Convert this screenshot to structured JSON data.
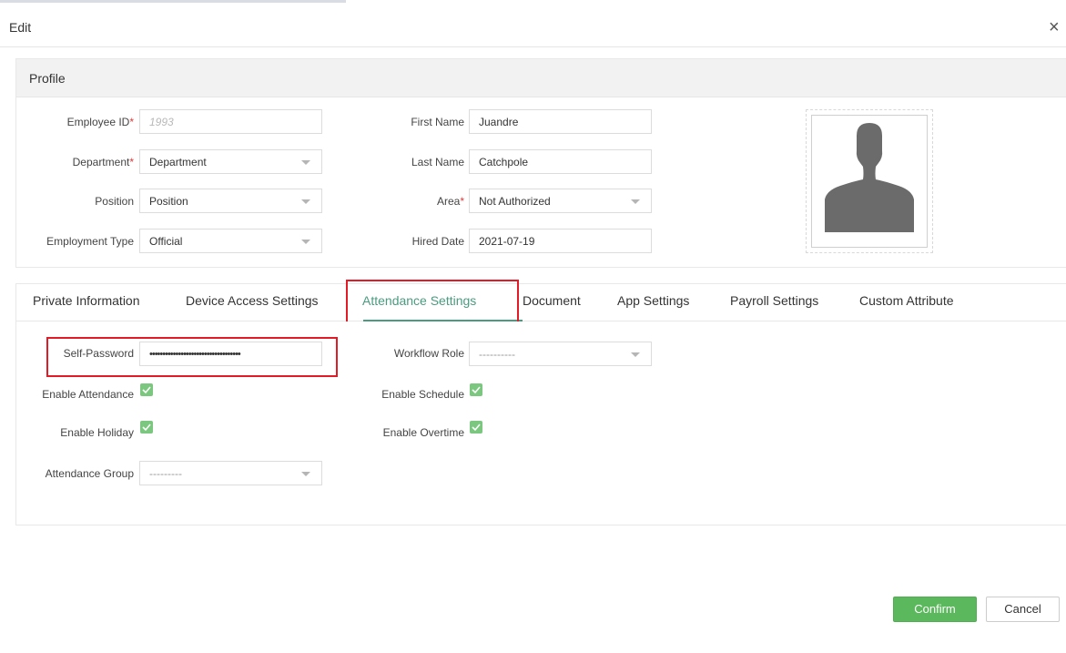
{
  "dialog": {
    "title": "Edit",
    "close_icon": "close-icon"
  },
  "profile": {
    "header": "Profile",
    "employee_id": {
      "label": "Employee ID",
      "placeholder": "1993"
    },
    "department": {
      "label": "Department",
      "value": "Department"
    },
    "position": {
      "label": "Position",
      "value": "Position"
    },
    "employment_type": {
      "label": "Employment Type",
      "value": "Official"
    },
    "first_name": {
      "label": "First Name",
      "value": "Juandre"
    },
    "last_name": {
      "label": "Last Name",
      "value": "Catchpole"
    },
    "area": {
      "label": "Area",
      "value": "Not Authorized"
    },
    "hired_date": {
      "label": "Hired Date",
      "value": "2021-07-19"
    },
    "required_mark": "*",
    "photo_icon": "avatar-placeholder-icon"
  },
  "tabs": [
    {
      "label": "Private Information"
    },
    {
      "label": "Device Access Settings"
    },
    {
      "label": "Attendance Settings",
      "active": true
    },
    {
      "label": "Document"
    },
    {
      "label": "App Settings"
    },
    {
      "label": "Payroll Settings"
    },
    {
      "label": "Custom Attribute"
    }
  ],
  "attendance": {
    "self_password": {
      "label": "Self-Password",
      "value": "•••••••••••••••••••••••••••••••••••"
    },
    "enable_attendance": {
      "label": "Enable Attendance",
      "checked": true
    },
    "enable_holiday": {
      "label": "Enable Holiday",
      "checked": true
    },
    "attendance_group": {
      "label": "Attendance Group",
      "value": "---------"
    },
    "workflow_role": {
      "label": "Workflow Role",
      "value": "----------"
    },
    "enable_schedule": {
      "label": "Enable Schedule",
      "checked": true
    },
    "enable_overtime": {
      "label": "Enable Overtime",
      "checked": true
    }
  },
  "footer": {
    "confirm_label": "Confirm",
    "cancel_label": "Cancel"
  },
  "colors": {
    "accent": "#4a9b80",
    "confirm": "#5cb85c",
    "highlight": "#e21b26",
    "checkbox": "#7cc77f",
    "required": "#e03a3a"
  }
}
